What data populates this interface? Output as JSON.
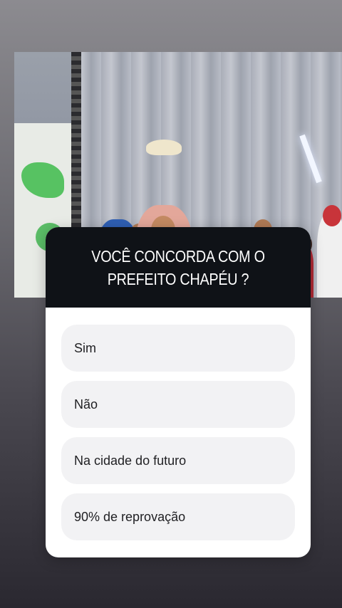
{
  "story_media": {
    "description_icon": "stage-photo"
  },
  "quiz": {
    "question": "VOCÊ CONCORDA COM O PREFEITO CHAPÉU ?",
    "options": [
      {
        "label": "Sim"
      },
      {
        "label": "Não"
      },
      {
        "label": "Na cidade do futuro"
      },
      {
        "label": "90% de reprovação"
      }
    ]
  },
  "colors": {
    "card_header": "#0f1217",
    "option_bg": "#f2f2f4",
    "card_bg": "#ffffff"
  }
}
